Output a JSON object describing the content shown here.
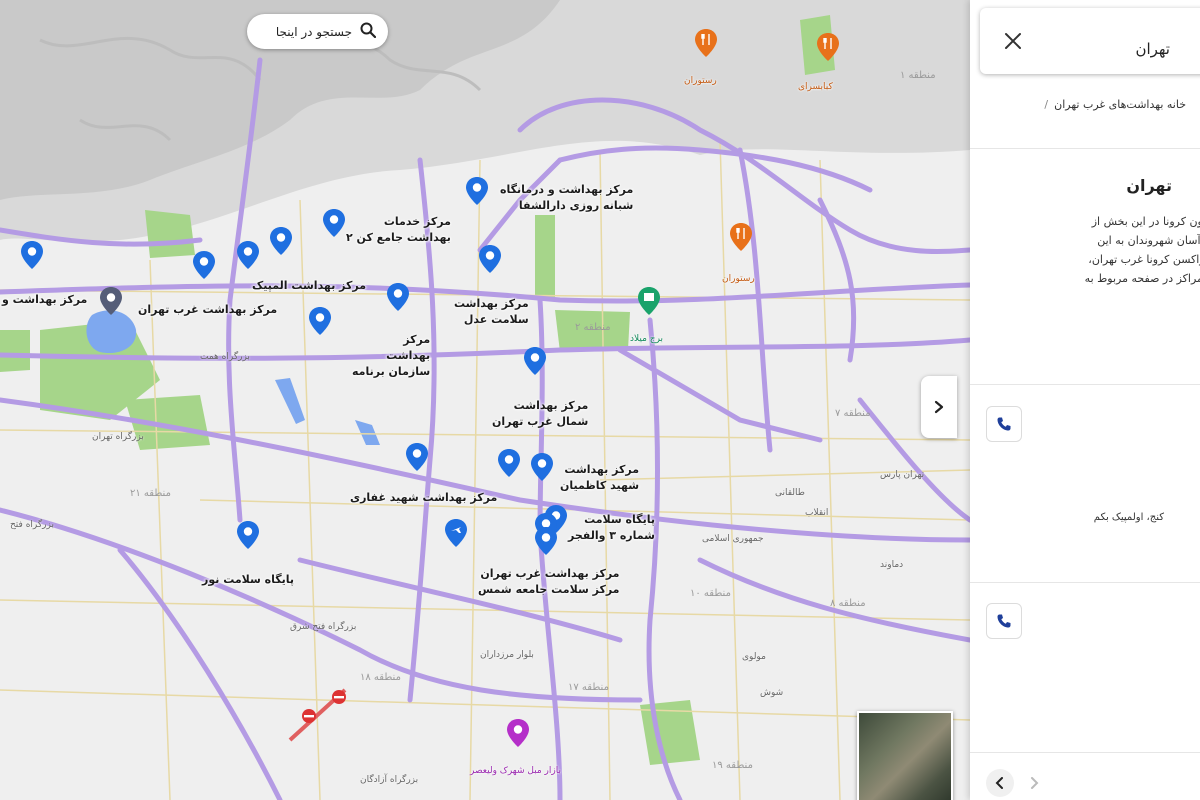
{
  "search": {
    "placeholder": "جستجو در اینجا"
  },
  "markers": [
    {
      "name": "marker-health-center-west-tehran-far-left",
      "label": "مرکز بهداشت و",
      "color": "#1f6fe0"
    },
    {
      "name": "marker-health-center-west-tehran",
      "label": "مرکز بهداشت غرب تهران",
      "color": "#1f6fe0"
    },
    {
      "name": "marker-health-center-olympic",
      "label": "مرکز بهداشت المپیک",
      "color": "#1f6fe0"
    },
    {
      "name": "marker-comprehensive-services",
      "label": "مرکز خدمات\nبهداشت جامع کن ۲",
      "color": "#1f6fe0"
    },
    {
      "name": "marker-dar-al-shafa",
      "label": "مرکز بهداشت و درمانگاه\nشبانه روزی دارالشفا",
      "color": "#1f6fe0"
    },
    {
      "name": "marker-health-adl",
      "label": "مرکز بهداشت\nسلامت عدل",
      "color": "#1f6fe0"
    },
    {
      "name": "marker-planning-org",
      "label": "مرکز\nبهداشت\nسازمان برنامه",
      "color": "#1f6fe0"
    },
    {
      "name": "marker-north-west-tehran",
      "label": "مرکز بهداشت\nشمال غرب تهران",
      "color": "#1f6fe0"
    },
    {
      "name": "marker-shahid-ghaffari",
      "label": "مرکز بهداشت شهید غفاری",
      "color": "#1f6fe0"
    },
    {
      "name": "marker-shahid-kazemian",
      "label": "مرکز بهداشت\nشهید کاظمیان",
      "color": "#1f6fe0"
    },
    {
      "name": "marker-valfajr",
      "label": "پایگاه سلامت\nشماره ۳ والفجر",
      "color": "#1f6fe0"
    },
    {
      "name": "marker-shams",
      "label": "مرکز بهداشت غرب تهران\nمرکز سلامت جامعه شمس",
      "color": "#1f6fe0"
    },
    {
      "name": "marker-noor",
      "label": "پایگاه سلامت نور",
      "color": "#1f6fe0"
    }
  ],
  "pois": [
    {
      "name": "poi-restaurant-1",
      "label": "رستوران",
      "color": "#e8711a"
    },
    {
      "name": "poi-restaurant-2",
      "label": "کبابسرای",
      "color": "#e8711a"
    },
    {
      "name": "poi-restaurant-3",
      "label": "رستوران",
      "color": "#e8711a"
    },
    {
      "name": "poi-tower",
      "label": "برج میلاد",
      "color": "#1aa36b"
    },
    {
      "name": "poi-mall",
      "label": "بازار مبل شهرک ولیعصر",
      "color": "#b52fc9"
    }
  ],
  "districts": [
    "منطقه ۱",
    "منطقه ۲",
    "منطقه ۷",
    "منطقه ۸",
    "منطقه ۲۱",
    "منطقه ۱۰",
    "منطقه ۱۸",
    "منطقه ۱۷",
    "منطقه ۱۹"
  ],
  "roads": [
    "بزرگراه همت",
    "بزرگراه تهران",
    "بزرگراه فتح",
    "بزرگراه فتح شرق",
    "بزرگراه آزادگان",
    "بلوار مرزداران",
    "طالقانی",
    "انقلاب",
    "جمهوری اسلامی",
    "شوش",
    "مولوی",
    "تهران پارس",
    "دماوند"
  ],
  "panel": {
    "header_title": "تهران",
    "close_label": "بستن",
    "breadcrumb_separator": "/",
    "breadcrumb": "خانه بهداشت‌های غرب تهران",
    "title": "تهران",
    "description_lines": [
      "ر واکسیناسیون کرونا در این بخش از",
      "ی دسترسی آسان شهروندان به این",
      "راکز تزریق واکسن کرونا غرب تهران،",
      "ر یک از این مراکز در صفحه مربوط به"
    ],
    "address_1": "کنج، اولمپیک بکم"
  }
}
